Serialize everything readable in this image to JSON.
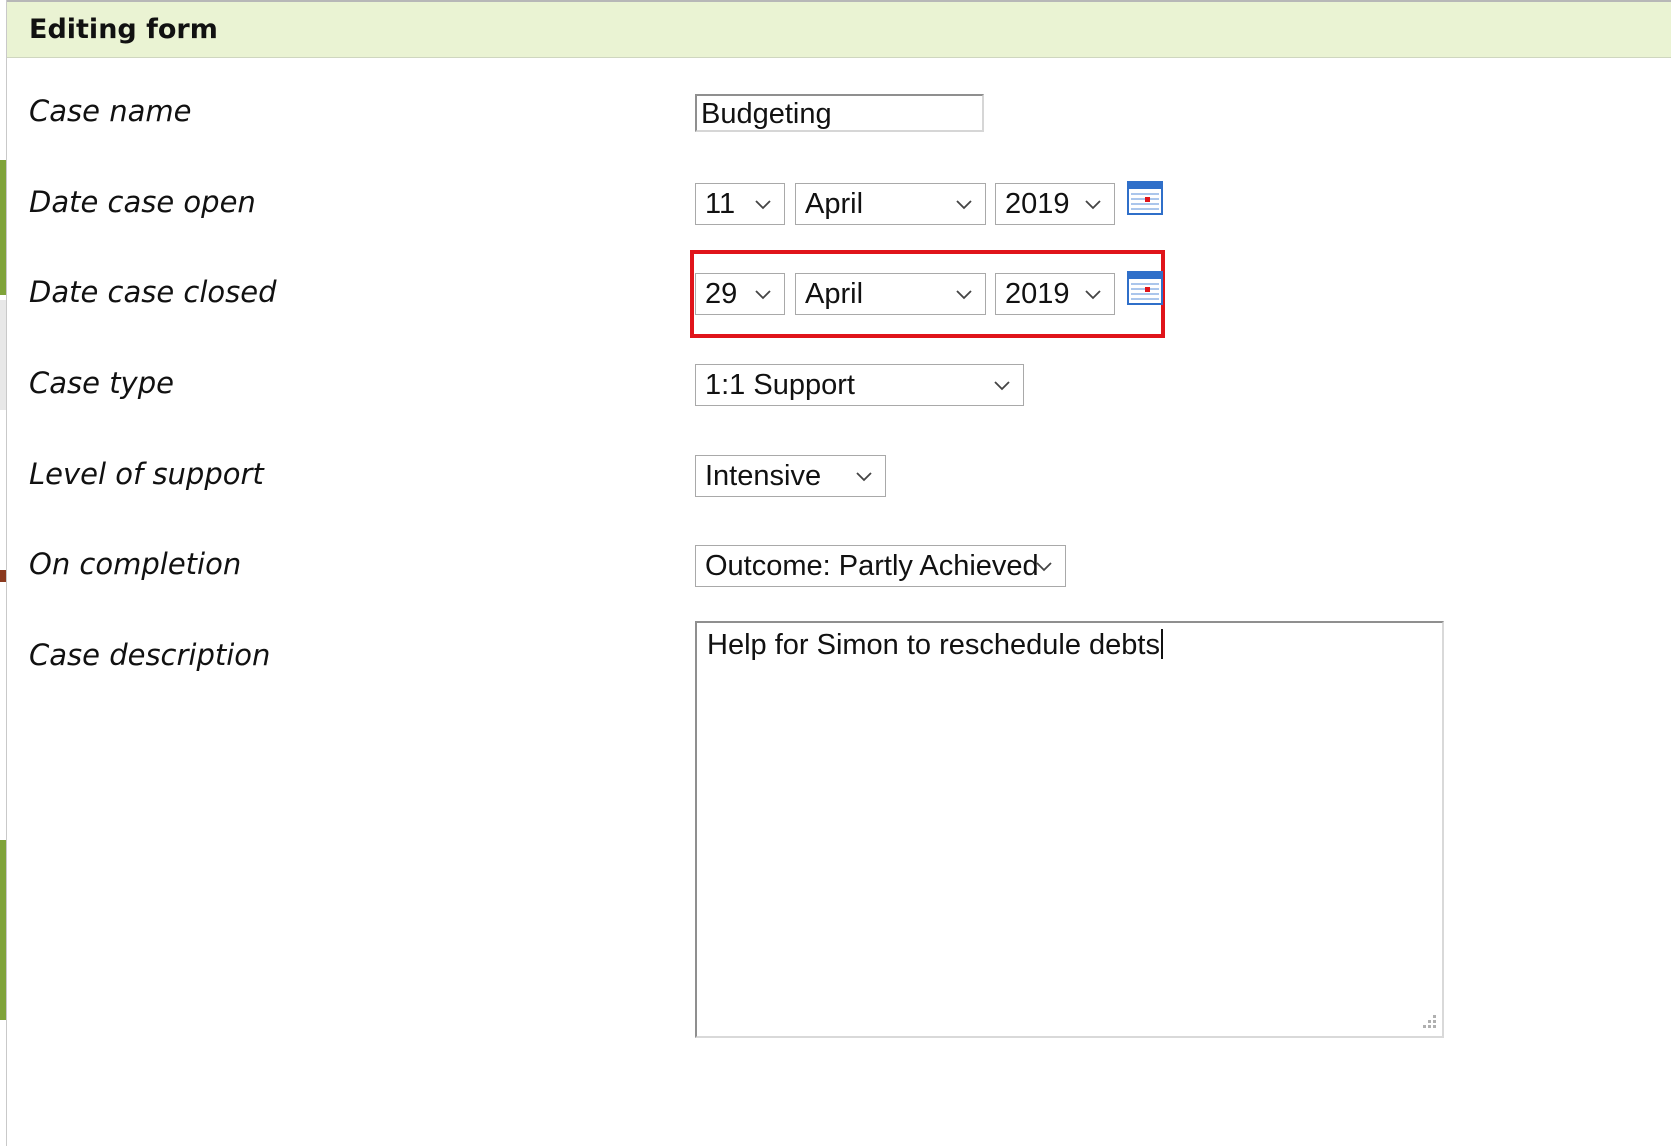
{
  "dialog": {
    "title": "Editing form"
  },
  "form": {
    "case_name": {
      "label": "Case name",
      "value": "Budgeting"
    },
    "date_open": {
      "label": "Date case open",
      "day": "11",
      "month": "April",
      "year": "2019"
    },
    "date_closed": {
      "label": "Date case closed",
      "day": "29",
      "month": "April",
      "year": "2019"
    },
    "case_type": {
      "label": "Case type",
      "value": "1:1 Support"
    },
    "level_of_support": {
      "label": "Level of support",
      "value": "Intensive"
    },
    "on_completion": {
      "label": "On completion",
      "value": "Outcome: Partly Achieved"
    },
    "case_description": {
      "label": "Case description",
      "value": "Help for Simon to reschedule debts"
    }
  },
  "icons": {
    "calendar": "calendar-icon",
    "dropdown": "chevron-down-icon"
  },
  "colors": {
    "header_bg": "#eaf3d3",
    "highlight": "#e0141a",
    "calendar_blue": "#2f6fc9"
  }
}
